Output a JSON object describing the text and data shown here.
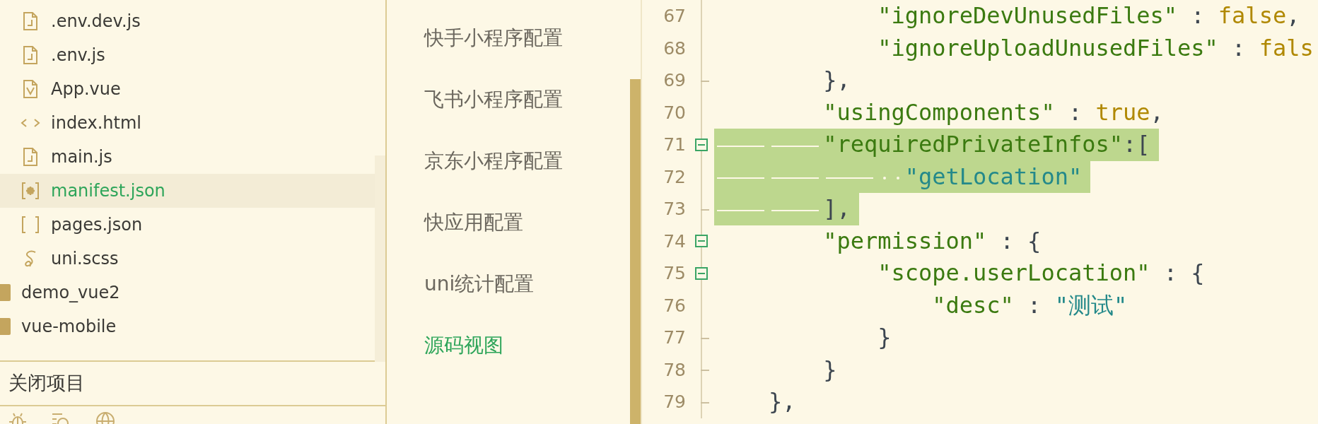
{
  "file_tree": [
    {
      "kind": "project",
      "children": [
        {
          "label": ".env.dev.js",
          "kind": "js",
          "selected": false
        },
        {
          "label": ".env.js",
          "kind": "js",
          "selected": false
        },
        {
          "label": "App.vue",
          "kind": "vue",
          "selected": false
        },
        {
          "label": "index.html",
          "kind": "html",
          "selected": false
        },
        {
          "label": "main.js",
          "kind": "js",
          "selected": false
        },
        {
          "label": "manifest.json",
          "kind": "config",
          "selected": true
        },
        {
          "label": "pages.json",
          "kind": "json",
          "selected": false
        },
        {
          "label": "uni.scss",
          "kind": "scss",
          "selected": false
        }
      ]
    },
    {
      "kind": "project",
      "label": "demo_vue2",
      "selected": false
    },
    {
      "kind": "project",
      "label": "vue-mobile",
      "selected": false
    }
  ],
  "closed_projects": {
    "label": "关闭项目"
  },
  "settings_nav": [
    {
      "label": "快手小程序配置",
      "selected": false
    },
    {
      "label": "飞书小程序配置",
      "selected": false
    },
    {
      "label": "京东小程序配置",
      "selected": false
    },
    {
      "label": "快应用配置",
      "selected": false
    },
    {
      "label": "uni统计配置",
      "selected": false
    },
    {
      "label": "源码视图",
      "selected": true
    }
  ],
  "editor": {
    "lines": [
      {
        "number": "67",
        "collapsible": false,
        "block_end": false,
        "selected": false,
        "tokens": [
          {
            "kind": "key",
            "text": "            \"ignoreDevUnusedFiles\""
          },
          {
            "kind": "punct",
            "text": " : "
          },
          {
            "kind": "bool",
            "text": "false"
          },
          {
            "kind": "punct",
            "text": ","
          }
        ]
      },
      {
        "number": "68",
        "collapsible": false,
        "block_end": false,
        "selected": false,
        "tokens": [
          {
            "kind": "key",
            "text": "            \"ignoreUploadUnusedFiles\""
          },
          {
            "kind": "punct",
            "text": " : "
          },
          {
            "kind": "bool",
            "text": "fals"
          }
        ]
      },
      {
        "number": "69",
        "collapsible": false,
        "block_end": true,
        "selected": false,
        "tokens": [
          {
            "kind": "punct",
            "text": "        },"
          }
        ]
      },
      {
        "number": "70",
        "collapsible": false,
        "block_end": false,
        "selected": false,
        "tokens": [
          {
            "kind": "key",
            "text": "        \"usingComponents\""
          },
          {
            "kind": "punct",
            "text": " : "
          },
          {
            "kind": "bool",
            "text": "true"
          },
          {
            "kind": "punct",
            "text": ","
          }
        ]
      },
      {
        "number": "71",
        "collapsible": true,
        "block_end": false,
        "selected": true,
        "tokens": [
          {
            "kind": "key",
            "text": "\t\t\"requiredPrivateInfos\""
          },
          {
            "kind": "punct",
            "text": ":["
          }
        ]
      },
      {
        "number": "72",
        "collapsible": false,
        "block_end": false,
        "selected": true,
        "tokens": [
          {
            "kind": "string",
            "text": "\t\t\t  \"getLocation\""
          }
        ]
      },
      {
        "number": "73",
        "collapsible": false,
        "block_end": true,
        "selected": true,
        "tokens": [
          {
            "kind": "punct",
            "text": "\t\t],"
          }
        ]
      },
      {
        "number": "74",
        "collapsible": true,
        "block_end": false,
        "selected": false,
        "tokens": [
          {
            "kind": "key",
            "text": "        \"permission\""
          },
          {
            "kind": "punct",
            "text": " : {"
          }
        ]
      },
      {
        "number": "75",
        "collapsible": true,
        "block_end": false,
        "selected": false,
        "tokens": [
          {
            "kind": "key",
            "text": "            \"scope.userLocation\""
          },
          {
            "kind": "punct",
            "text": " : {"
          }
        ]
      },
      {
        "number": "76",
        "collapsible": false,
        "block_end": false,
        "selected": false,
        "tokens": [
          {
            "kind": "key",
            "text": "                \"desc\""
          },
          {
            "kind": "punct",
            "text": " : "
          },
          {
            "kind": "string",
            "text": "\"测试\""
          }
        ]
      },
      {
        "number": "77",
        "collapsible": false,
        "block_end": true,
        "selected": false,
        "tokens": [
          {
            "kind": "punct",
            "text": "            }"
          }
        ]
      },
      {
        "number": "78",
        "collapsible": false,
        "block_end": true,
        "selected": false,
        "tokens": [
          {
            "kind": "punct",
            "text": "        }"
          }
        ]
      },
      {
        "number": "79",
        "collapsible": false,
        "block_end": true,
        "selected": false,
        "tokens": [
          {
            "kind": "punct",
            "text": "    },"
          }
        ]
      }
    ]
  }
}
